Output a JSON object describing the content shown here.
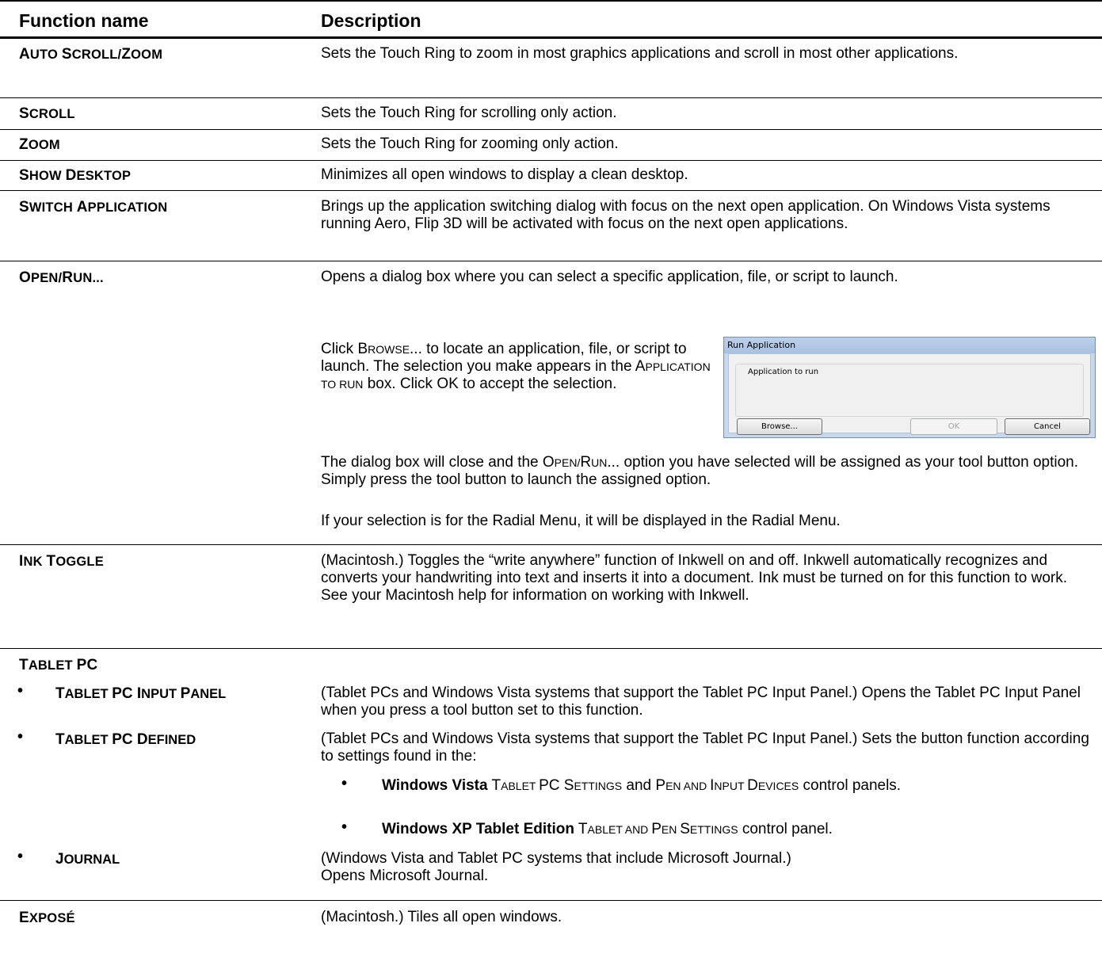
{
  "header": {
    "function_name": "Function name",
    "description": "Description"
  },
  "rows": [
    {
      "name_parts": [
        "A",
        "UTO ",
        "S",
        "CROLL/",
        "Z",
        "OOM"
      ],
      "desc": "Sets the Touch Ring to zoom in most graphics applications and scroll in most other applications."
    },
    {
      "name_parts": [
        "S",
        "CROLL"
      ],
      "desc": "Sets the Touch Ring for scrolling only action."
    },
    {
      "name_parts": [
        "Z",
        "OOM"
      ],
      "desc": "Sets the Touch Ring for zooming only action."
    },
    {
      "name_parts": [
        "S",
        "HOW ",
        "D",
        "ESKTOP"
      ],
      "desc": "Minimizes all open windows to display a clean desktop."
    },
    {
      "name_parts": [
        "S",
        "WITCH ",
        "A",
        "PPLICATION"
      ],
      "desc": "Brings up the application switching dialog with focus on the next open application. On Windows Vista systems running Aero, Flip 3D will be activated with focus on the next open applications."
    },
    {
      "name_parts": [
        "O",
        "PEN/",
        "R",
        "UN..."
      ],
      "desc": "Opens a dialog box where you can select a specific application, file, or script to launch."
    }
  ],
  "open_run": {
    "click_browse": [
      "Click ",
      "B",
      "ROWSE",
      "... to locate an application, file, or script  to launch.  The selection you make appears in the ",
      "A",
      "PPLICATION TO RUN",
      " box.  Click OK to accept the selection."
    ],
    "dialog_close": [
      "The dialog box will close and the ",
      "O",
      "PEN/",
      "R",
      "UN",
      "... option you have selected will be assigned as your tool button option.  Simply press the tool button to launch the assigned option."
    ],
    "radial": "If your selection is for the Radial Menu, it will be displayed in the Radial Menu."
  },
  "dialog": {
    "title": "Run Application",
    "group_label": "Application to run",
    "browse": "Browse...",
    "ok": "OK",
    "cancel": "Cancel"
  },
  "ink_toggle": {
    "name_parts": [
      "I",
      "NK ",
      "T",
      "OGGLE"
    ],
    "desc": "(Macintosh.)  Toggles the “write anywhere” function of Inkwell on and off.  Inkwell automatically recognizes and converts your handwriting into text and inserts it into a document.  Ink must be turned on for this function to work.  See your Macintosh help for information on working with Inkwell."
  },
  "tablet_pc": {
    "name_parts": [
      "T",
      "ABLET ",
      "PC"
    ],
    "bullet": "•",
    "input_panel": {
      "name_parts": [
        "T",
        "ABLET ",
        "PC I",
        "NPUT ",
        "P",
        "ANEL"
      ],
      "desc": "(Tablet PCs and Windows Vista systems that support the Tablet PC Input Panel.) Opens the Tablet PC Input Panel when you press a tool button set to this function."
    },
    "defined": {
      "name_parts": [
        "T",
        "ABLET ",
        "PC D",
        "EFINED"
      ],
      "desc": "(Tablet PCs and Windows Vista systems that support the Tablet PC Input Panel.) Sets the button function according to settings found in the:",
      "vista_bold": "Windows Vista",
      "vista_rest": [
        "T",
        "ABLET ",
        "PC S",
        "ETTINGS",
        " and ",
        "P",
        "EN AND ",
        "I",
        "NPUT ",
        "D",
        "EVICES",
        " control panels."
      ],
      "xp_bold": "Windows XP Tablet Edition",
      "xp_rest": [
        "T",
        "ABLET AND ",
        "P",
        "EN ",
        "S",
        "ETTINGS",
        " control panel."
      ]
    },
    "journal": {
      "name_parts": [
        "J",
        "OURNAL"
      ],
      "desc_line1": "(Windows Vista and Tablet PC systems that include Microsoft Journal.)",
      "desc_line2": "Opens Microsoft Journal."
    }
  },
  "expose": {
    "name_parts": [
      "E",
      "XPOSÉ"
    ],
    "desc": "(Macintosh.)  Tiles all open windows."
  }
}
